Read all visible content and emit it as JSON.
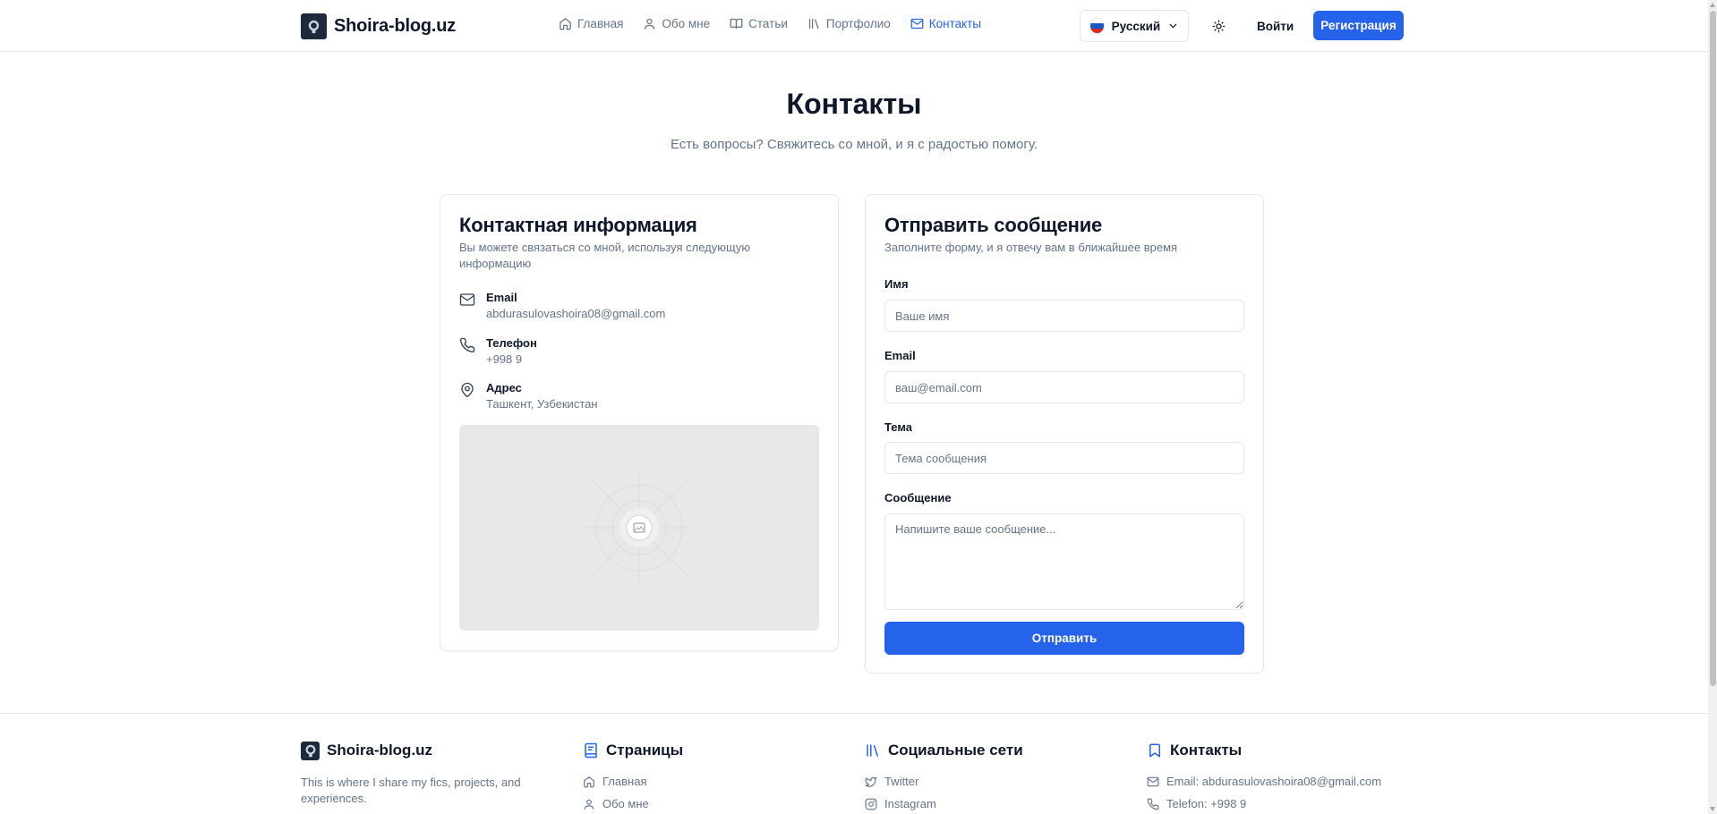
{
  "brand": {
    "name": "Shoira-blog.uz"
  },
  "nav": [
    {
      "label": "Главная",
      "icon": "home-icon"
    },
    {
      "label": "Обо мне",
      "icon": "user-icon"
    },
    {
      "label": "Статьи",
      "icon": "book-open-icon"
    },
    {
      "label": "Портфолио",
      "icon": "library-icon"
    },
    {
      "label": "Контакты",
      "icon": "mail-icon",
      "active": true
    }
  ],
  "header": {
    "language": "Русский",
    "login_label": "Войти",
    "register_label": "Регистрация"
  },
  "hero": {
    "title": "Контакты",
    "subtitle": "Есть вопросы? Свяжитесь со мной, и я с радостью помогу."
  },
  "contact_info": {
    "title": "Контактная информация",
    "description": "Вы можете связаться со мной, используя следующую информацию",
    "items": [
      {
        "label": "Email",
        "value": "abdurasulovashoira08@gmail.com",
        "icon": "mail-icon"
      },
      {
        "label": "Телефон",
        "value": "+998 9",
        "icon": "phone-icon"
      },
      {
        "label": "Адрес",
        "value": "Ташкент, Узбекистан",
        "icon": "map-pin-icon"
      }
    ],
    "map_icon": "image-placeholder-icon"
  },
  "form": {
    "title": "Отправить сообщение",
    "description": "Заполните форму, и я отвечу вам в ближайшее время",
    "name_label": "Имя",
    "name_placeholder": "Ваше имя",
    "email_label": "Email",
    "email_placeholder": "ваш@email.com",
    "subject_label": "Тема",
    "subject_placeholder": "Тема сообщения",
    "message_label": "Сообщение",
    "message_placeholder": "Напишите ваше сообщение...",
    "submit_label": "Отправить"
  },
  "footer": {
    "brand_name": "Shoira-blog.uz",
    "about_text": "This is where I share my fics, projects, and experiences.",
    "pages_title": "Страницы",
    "pages": [
      "Главная",
      "Обо мне"
    ],
    "social_title": "Социальные сети",
    "social": [
      "Twitter",
      "Instagram"
    ],
    "contacts_title": "Контакты",
    "contacts": [
      "Email: abdurasulovashoira08@gmail.com",
      "Telefon: +998 9"
    ]
  },
  "colors": {
    "accent": "#2563eb",
    "text": "#0f172a",
    "muted": "#64748b",
    "border": "#e5e7eb"
  }
}
